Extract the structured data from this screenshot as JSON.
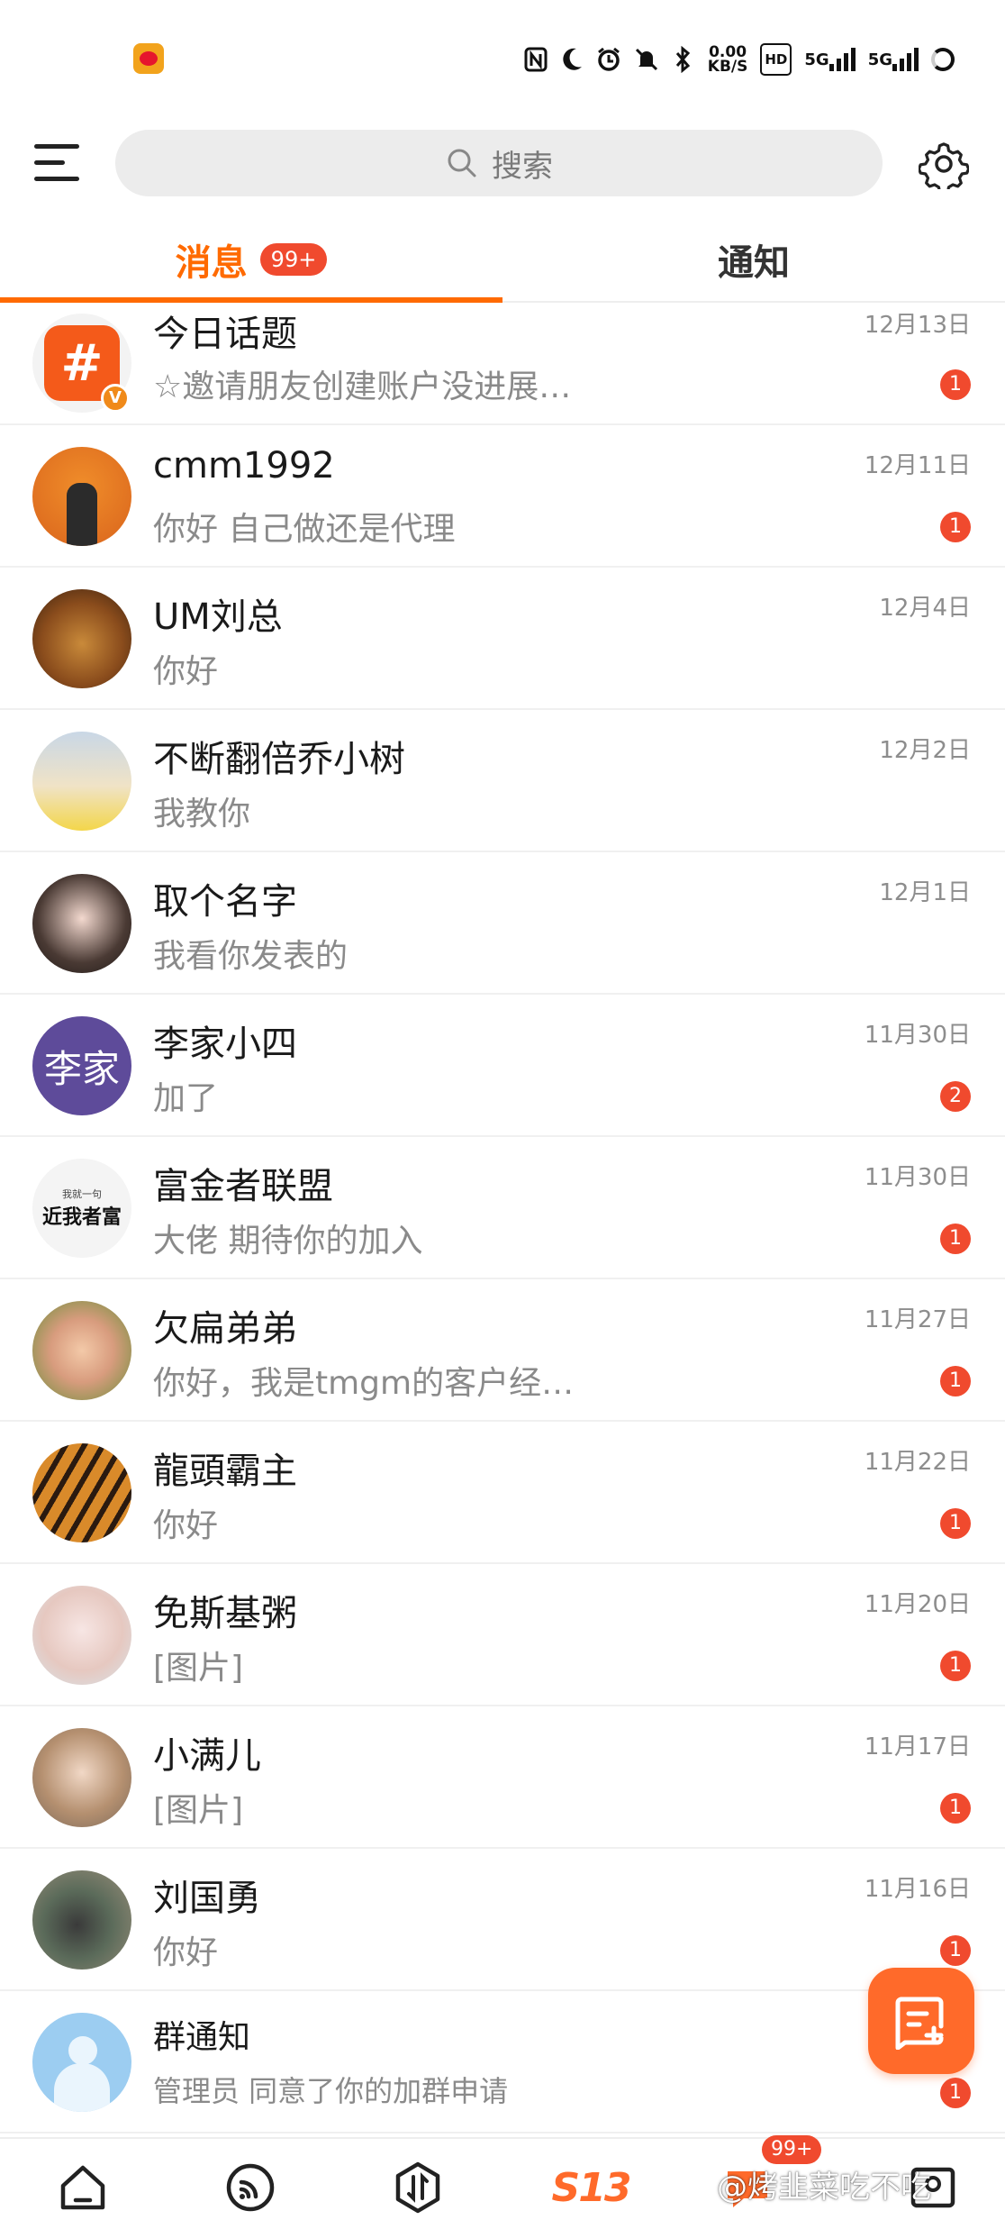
{
  "status_bar": {
    "speed_value": "0.00",
    "speed_unit": "KB/S",
    "hd_label": "HD",
    "net1": "5G",
    "net2": "5G"
  },
  "header": {
    "search_placeholder": "搜索"
  },
  "tabs": [
    {
      "label": "消息",
      "badge": "99+",
      "active": true
    },
    {
      "label": "通知",
      "active": false
    }
  ],
  "conversations": [
    {
      "name": "今日话题",
      "preview": "☆邀请朋友创建账户没进展…",
      "time": "12月13日",
      "unread": "1",
      "avatar": "hashtag-topic"
    },
    {
      "name": "cmm1992",
      "preview": "你好 自己做还是代理",
      "time": "12月11日",
      "unread": "1",
      "avatar": "photo"
    },
    {
      "name": "UM刘总",
      "preview": "你好",
      "time": "12月4日",
      "unread": "",
      "avatar": "lion-photo"
    },
    {
      "name": "不断翻倍乔小树",
      "preview": "我教你",
      "time": "12月2日",
      "unread": "",
      "avatar": "photo"
    },
    {
      "name": "取个名字",
      "preview": "我看你发表的",
      "time": "12月1日",
      "unread": "",
      "avatar": "photo"
    },
    {
      "name": "李家小四",
      "preview": "加了",
      "time": "11月30日",
      "unread": "2",
      "avatar": "text",
      "avatar_text": "李家"
    },
    {
      "name": "富金者联盟",
      "preview": "大佬 期待你的加入",
      "time": "11月30日",
      "unread": "1",
      "avatar": "text-logo",
      "avatar_small": "我就一句",
      "avatar_big": "近我者富"
    },
    {
      "name": "欠扁弟弟",
      "preview": "你好，我是tmgm的客户经…",
      "time": "11月27日",
      "unread": "1",
      "avatar": "baby-photo"
    },
    {
      "name": "龍頭霸主",
      "preview": "你好",
      "time": "11月22日",
      "unread": "1",
      "avatar": "tiger-photo"
    },
    {
      "name": "免斯基粥",
      "preview": "[图片]",
      "time": "11月20日",
      "unread": "1",
      "avatar": "photo"
    },
    {
      "name": "小满儿",
      "preview": "[图片]",
      "time": "11月17日",
      "unread": "1",
      "avatar": "photo"
    },
    {
      "name": "刘国勇",
      "preview": "你好",
      "time": "11月16日",
      "unread": "1",
      "avatar": "watch-photo"
    },
    {
      "name": "群通知",
      "preview": "管理员 同意了你的加群申请",
      "time": "",
      "unread": "1",
      "avatar": "group-icon"
    }
  ],
  "bottom_nav": {
    "items": [
      "home",
      "video",
      "discover",
      "s13",
      "messages",
      "profile"
    ],
    "s13_label": "S13",
    "messages_badge": "99+",
    "watermark": "@烤韭菜吃不吃"
  },
  "colors": {
    "accent": "#ff6a00",
    "badge": "#f04a2e"
  }
}
